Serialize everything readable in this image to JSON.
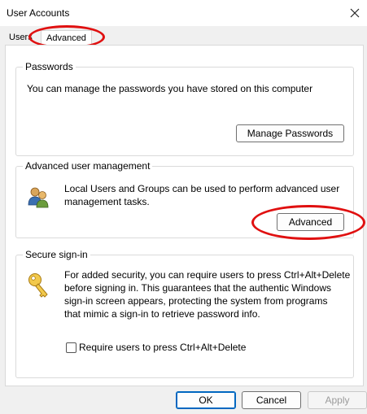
{
  "window": {
    "title": "User Accounts"
  },
  "tabs": [
    {
      "label": "Users"
    },
    {
      "label": "Advanced"
    }
  ],
  "passwords": {
    "group_title": "Passwords",
    "description": "You can manage the passwords you have stored on this computer",
    "button_label": "Manage Passwords"
  },
  "advanced_user_mgmt": {
    "group_title": "Advanced user management",
    "description_line1": "Local Users and Groups can be used to perform advanced user",
    "description_line2": "management tasks.",
    "button_label": "Advanced"
  },
  "secure_signin": {
    "group_title": "Secure sign-in",
    "lines": [
      "For added security, you can require users to press Ctrl+Alt+Delete",
      "before signing in. This guarantees that the authentic Windows",
      "sign-in screen appears, protecting the system from programs",
      "that mimic a sign-in to retrieve password info."
    ],
    "checkbox_label": "Require users to press Ctrl+Alt+Delete",
    "checkbox_checked": false
  },
  "footer": {
    "ok_label": "OK",
    "cancel_label": "Cancel",
    "apply_label": "Apply"
  },
  "annotation_color": "#e01010"
}
